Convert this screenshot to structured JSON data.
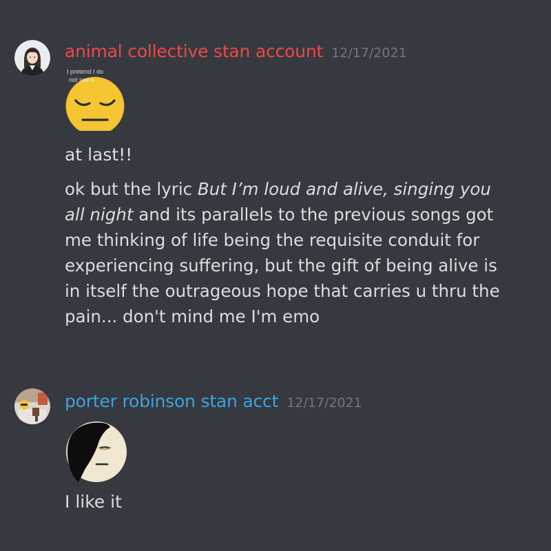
{
  "messages": [
    {
      "username": "animal collective stan account",
      "username_color": "#f04747",
      "timestamp": "12/17/2021",
      "sticker_caption": "I pretend I do not see it",
      "sticker_icon": "pensive-face-sticker",
      "lines": [
        "at last!!"
      ],
      "long_text": {
        "prefix": "ok but the lyric ",
        "italic": "But I’m loud and alive, singing you all night",
        "suffix": " and its parallels to the previous songs got me thinking of life being the requisite conduit for experiencing suffering, but the gift of being alive is in itself the outrageous hope that carries u thru the pain... don't mind me I'm emo"
      }
    },
    {
      "username": "porter robinson stan acct",
      "username_color": "#3ca4e0",
      "timestamp": "12/17/2021",
      "sticker_icon": "emo-hair-face-sticker",
      "lines": [
        "I like it"
      ]
    }
  ]
}
